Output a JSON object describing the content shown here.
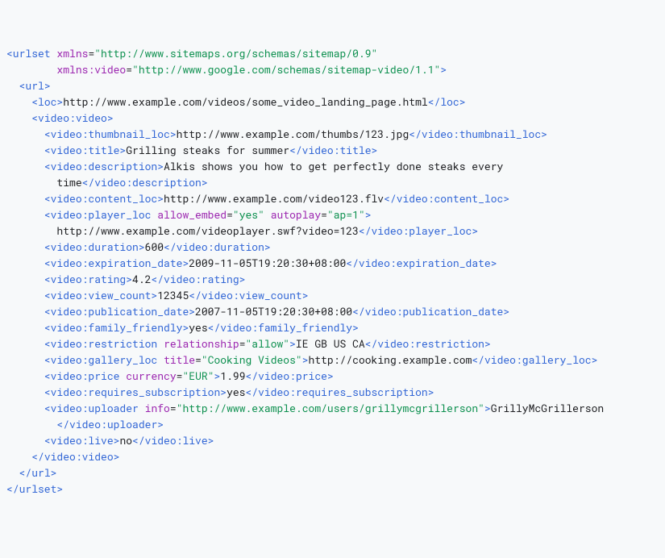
{
  "urlset": {
    "xmlns": "http://www.sitemaps.org/schemas/sitemap/0.9",
    "xmlns_video": "http://www.google.com/schemas/sitemap-video/1.1",
    "url": {
      "loc": "http://www.example.com/videos/some_video_landing_page.html",
      "video": {
        "thumbnail_loc": "http://www.example.com/thumbs/123.jpg",
        "title": "Grilling steaks for summer",
        "description": "Alkis shows you how to get perfectly done steaks every\n        time",
        "content_loc": "http://www.example.com/video123.flv",
        "player_loc": {
          "allow_embed": "yes",
          "autoplay": "ap=1",
          "value": "http://www.example.com/videoplayer.swf?video=123"
        },
        "duration": "600",
        "expiration_date": "2009-11-05T19:20:30+08:00",
        "rating": "4.2",
        "view_count": "12345",
        "publication_date": "2007-11-05T19:20:30+08:00",
        "family_friendly": "yes",
        "restriction": {
          "relationship": "allow",
          "value": "IE GB US CA"
        },
        "gallery_loc": {
          "title": "Cooking Videos",
          "value": "http://cooking.example.com"
        },
        "price": {
          "currency": "EUR",
          "value": "1.99"
        },
        "requires_subscription": "yes",
        "uploader": {
          "info": "http://www.example.com/users/grillymcgrillerson",
          "value": "GrillyMcGrillerson"
        },
        "live": "no"
      }
    }
  }
}
